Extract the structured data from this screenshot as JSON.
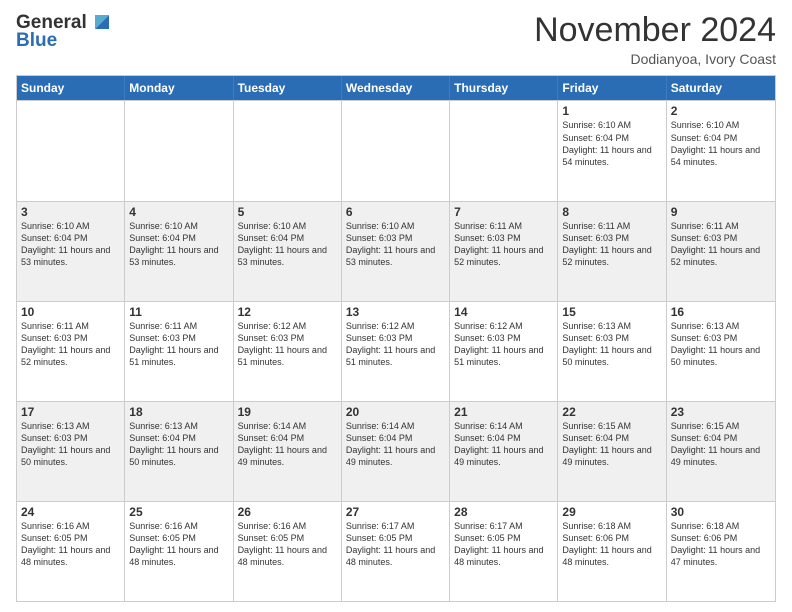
{
  "logo": {
    "general": "General",
    "blue": "Blue"
  },
  "header": {
    "month_year": "November 2024",
    "location": "Dodianyoa, Ivory Coast"
  },
  "days_of_week": [
    "Sunday",
    "Monday",
    "Tuesday",
    "Wednesday",
    "Thursday",
    "Friday",
    "Saturday"
  ],
  "weeks": [
    [
      {
        "day": "",
        "content": ""
      },
      {
        "day": "",
        "content": ""
      },
      {
        "day": "",
        "content": ""
      },
      {
        "day": "",
        "content": ""
      },
      {
        "day": "",
        "content": ""
      },
      {
        "day": "1",
        "content": "Sunrise: 6:10 AM\nSunset: 6:04 PM\nDaylight: 11 hours and 54 minutes."
      },
      {
        "day": "2",
        "content": "Sunrise: 6:10 AM\nSunset: 6:04 PM\nDaylight: 11 hours and 54 minutes."
      }
    ],
    [
      {
        "day": "3",
        "content": "Sunrise: 6:10 AM\nSunset: 6:04 PM\nDaylight: 11 hours and 53 minutes."
      },
      {
        "day": "4",
        "content": "Sunrise: 6:10 AM\nSunset: 6:04 PM\nDaylight: 11 hours and 53 minutes."
      },
      {
        "day": "5",
        "content": "Sunrise: 6:10 AM\nSunset: 6:04 PM\nDaylight: 11 hours and 53 minutes."
      },
      {
        "day": "6",
        "content": "Sunrise: 6:10 AM\nSunset: 6:03 PM\nDaylight: 11 hours and 53 minutes."
      },
      {
        "day": "7",
        "content": "Sunrise: 6:11 AM\nSunset: 6:03 PM\nDaylight: 11 hours and 52 minutes."
      },
      {
        "day": "8",
        "content": "Sunrise: 6:11 AM\nSunset: 6:03 PM\nDaylight: 11 hours and 52 minutes."
      },
      {
        "day": "9",
        "content": "Sunrise: 6:11 AM\nSunset: 6:03 PM\nDaylight: 11 hours and 52 minutes."
      }
    ],
    [
      {
        "day": "10",
        "content": "Sunrise: 6:11 AM\nSunset: 6:03 PM\nDaylight: 11 hours and 52 minutes."
      },
      {
        "day": "11",
        "content": "Sunrise: 6:11 AM\nSunset: 6:03 PM\nDaylight: 11 hours and 51 minutes."
      },
      {
        "day": "12",
        "content": "Sunrise: 6:12 AM\nSunset: 6:03 PM\nDaylight: 11 hours and 51 minutes."
      },
      {
        "day": "13",
        "content": "Sunrise: 6:12 AM\nSunset: 6:03 PM\nDaylight: 11 hours and 51 minutes."
      },
      {
        "day": "14",
        "content": "Sunrise: 6:12 AM\nSunset: 6:03 PM\nDaylight: 11 hours and 51 minutes."
      },
      {
        "day": "15",
        "content": "Sunrise: 6:13 AM\nSunset: 6:03 PM\nDaylight: 11 hours and 50 minutes."
      },
      {
        "day": "16",
        "content": "Sunrise: 6:13 AM\nSunset: 6:03 PM\nDaylight: 11 hours and 50 minutes."
      }
    ],
    [
      {
        "day": "17",
        "content": "Sunrise: 6:13 AM\nSunset: 6:03 PM\nDaylight: 11 hours and 50 minutes."
      },
      {
        "day": "18",
        "content": "Sunrise: 6:13 AM\nSunset: 6:04 PM\nDaylight: 11 hours and 50 minutes."
      },
      {
        "day": "19",
        "content": "Sunrise: 6:14 AM\nSunset: 6:04 PM\nDaylight: 11 hours and 49 minutes."
      },
      {
        "day": "20",
        "content": "Sunrise: 6:14 AM\nSunset: 6:04 PM\nDaylight: 11 hours and 49 minutes."
      },
      {
        "day": "21",
        "content": "Sunrise: 6:14 AM\nSunset: 6:04 PM\nDaylight: 11 hours and 49 minutes."
      },
      {
        "day": "22",
        "content": "Sunrise: 6:15 AM\nSunset: 6:04 PM\nDaylight: 11 hours and 49 minutes."
      },
      {
        "day": "23",
        "content": "Sunrise: 6:15 AM\nSunset: 6:04 PM\nDaylight: 11 hours and 49 minutes."
      }
    ],
    [
      {
        "day": "24",
        "content": "Sunrise: 6:16 AM\nSunset: 6:05 PM\nDaylight: 11 hours and 48 minutes."
      },
      {
        "day": "25",
        "content": "Sunrise: 6:16 AM\nSunset: 6:05 PM\nDaylight: 11 hours and 48 minutes."
      },
      {
        "day": "26",
        "content": "Sunrise: 6:16 AM\nSunset: 6:05 PM\nDaylight: 11 hours and 48 minutes."
      },
      {
        "day": "27",
        "content": "Sunrise: 6:17 AM\nSunset: 6:05 PM\nDaylight: 11 hours and 48 minutes."
      },
      {
        "day": "28",
        "content": "Sunrise: 6:17 AM\nSunset: 6:05 PM\nDaylight: 11 hours and 48 minutes."
      },
      {
        "day": "29",
        "content": "Sunrise: 6:18 AM\nSunset: 6:06 PM\nDaylight: 11 hours and 48 minutes."
      },
      {
        "day": "30",
        "content": "Sunrise: 6:18 AM\nSunset: 6:06 PM\nDaylight: 11 hours and 47 minutes."
      }
    ]
  ]
}
